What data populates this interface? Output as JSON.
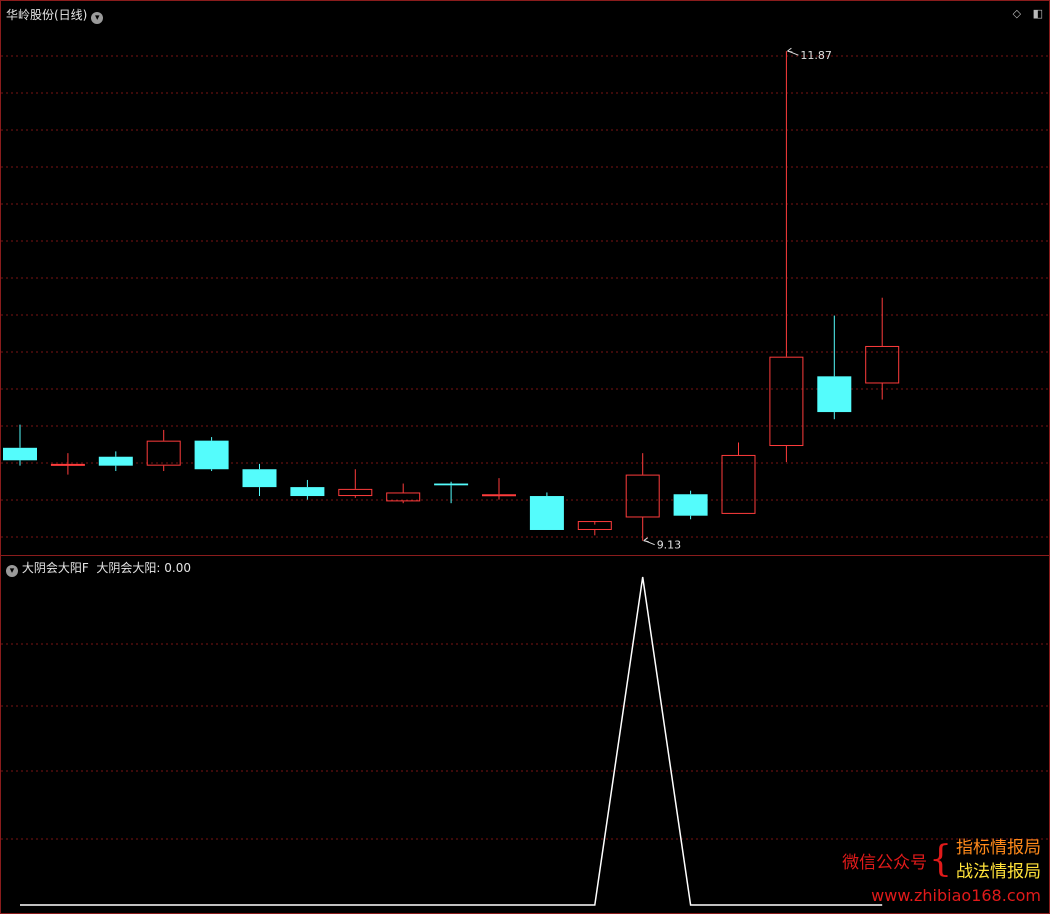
{
  "header": {
    "stock_title": "华岭股份(日线)",
    "panel_collapse_icon": "chevron-down-icon",
    "right_icons": [
      "diamond-icon",
      "window-icon"
    ]
  },
  "indicator": {
    "name": "大阴会大阳F",
    "series_label": "大阴会大阳",
    "value": "0.00"
  },
  "chart_data": [
    {
      "type": "candlestick",
      "title": "华岭股份(日线)",
      "annotations": [
        {
          "text": "11.87",
          "kind": "max"
        },
        {
          "text": "9.13",
          "kind": "min"
        }
      ],
      "colors": {
        "up": "#ff3c3c",
        "down": "#54fcfc",
        "grid": "#7a1414"
      },
      "ylim": [
        9.05,
        12.05
      ],
      "candles": [
        {
          "open": 9.65,
          "high": 9.78,
          "low": 9.55,
          "close": 9.58
        },
        {
          "open": 9.56,
          "high": 9.62,
          "low": 9.5,
          "close": 9.56
        },
        {
          "open": 9.6,
          "high": 9.63,
          "low": 9.52,
          "close": 9.55
        },
        {
          "open": 9.55,
          "high": 9.75,
          "low": 9.52,
          "close": 9.69
        },
        {
          "open": 9.69,
          "high": 9.71,
          "low": 9.52,
          "close": 9.53
        },
        {
          "open": 9.53,
          "high": 9.56,
          "low": 9.38,
          "close": 9.43
        },
        {
          "open": 9.43,
          "high": 9.47,
          "low": 9.36,
          "close": 9.38
        },
        {
          "open": 9.38,
          "high": 9.53,
          "low": 9.37,
          "close": 9.42
        },
        {
          "open": 9.35,
          "high": 9.45,
          "low": 9.34,
          "close": 9.4
        },
        {
          "open": 9.45,
          "high": 9.46,
          "low": 9.34,
          "close": 9.44
        },
        {
          "open": 9.38,
          "high": 9.48,
          "low": 9.36,
          "close": 9.39
        },
        {
          "open": 9.38,
          "high": 9.4,
          "low": 9.19,
          "close": 9.19
        },
        {
          "open": 9.19,
          "high": 9.22,
          "low": 9.16,
          "close": 9.24
        },
        {
          "open": 9.26,
          "high": 9.62,
          "low": 9.13,
          "close": 9.5
        },
        {
          "open": 9.39,
          "high": 9.41,
          "low": 9.25,
          "close": 9.27
        },
        {
          "open": 9.28,
          "high": 9.68,
          "low": 9.28,
          "close": 9.61
        },
        {
          "open": 9.66,
          "high": 11.87,
          "low": 9.57,
          "close": 10.16
        },
        {
          "open": 10.05,
          "high": 10.39,
          "low": 9.81,
          "close": 9.85
        },
        {
          "open": 10.01,
          "high": 10.49,
          "low": 9.92,
          "close": 10.22
        }
      ]
    },
    {
      "type": "line",
      "series": [
        {
          "name": "大阴会大阳",
          "values": [
            0,
            0,
            0,
            0,
            0,
            0,
            0,
            0,
            0,
            0,
            0,
            0,
            0,
            1,
            0,
            0,
            0,
            0,
            0
          ]
        }
      ],
      "ylim": [
        0,
        1
      ]
    }
  ],
  "watermark": {
    "left": "微信公众号",
    "brace": "{",
    "right_1": "指标情报局",
    "right_2": "战法情报局",
    "url": "www.zhibiao168.com"
  }
}
